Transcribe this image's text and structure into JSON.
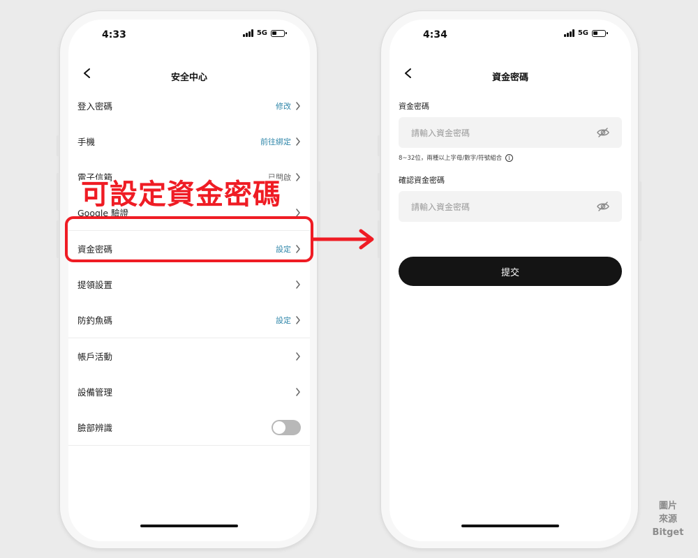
{
  "left_phone": {
    "status": {
      "time": "4:33",
      "network": "5G"
    },
    "title": "安全中心",
    "items": [
      {
        "label": "登入密碼",
        "value": "修改",
        "value_style": "link",
        "control": "chevron"
      },
      {
        "label": "手機",
        "value": "前往綁定",
        "value_style": "link",
        "control": "chevron"
      },
      {
        "label": "電子信箱",
        "value": "已開啟",
        "value_style": "muted",
        "control": "chevron"
      },
      {
        "label": "Google 驗證",
        "value": "",
        "value_style": "muted",
        "control": "chevron"
      },
      {
        "label": "資金密碼",
        "value": "設定",
        "value_style": "link",
        "control": "chevron"
      },
      {
        "label": "提領設置",
        "value": "",
        "value_style": "muted",
        "control": "chevron"
      },
      {
        "label": "防釣魚碼",
        "value": "設定",
        "value_style": "link",
        "control": "chevron"
      },
      {
        "label": "帳戶活動",
        "value": "",
        "value_style": "muted",
        "control": "chevron"
      },
      {
        "label": "設備管理",
        "value": "",
        "value_style": "muted",
        "control": "chevron"
      },
      {
        "label": "臉部辨識",
        "value": "",
        "value_style": "muted",
        "control": "toggle",
        "toggle_on": false
      }
    ]
  },
  "right_phone": {
    "status": {
      "time": "4:34",
      "network": "5G"
    },
    "title": "資金密碼",
    "password_field": {
      "label": "資金密碼",
      "placeholder": "請輸入資金密碼"
    },
    "hint": "8~32位，兩種以上字母/數字/符號組合",
    "confirm_field": {
      "label": "確認資金密碼",
      "placeholder": "請輸入資金密碼"
    },
    "submit_label": "提交"
  },
  "annotation": {
    "callout": "可設定資金密碼",
    "color": "#ef1c24"
  },
  "watermark": {
    "line1": "圖片",
    "line2": "來源",
    "line3": "Bitget"
  },
  "colors": {
    "link": "#2f86a9",
    "button": "#141414",
    "background": "#ebebeb"
  }
}
